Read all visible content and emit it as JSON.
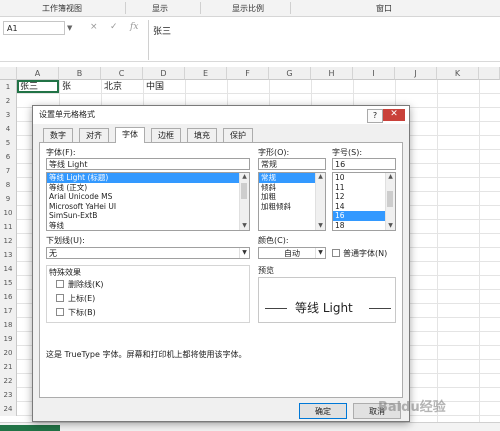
{
  "ribbon": {
    "groups": [
      "工作簿视图",
      "显示",
      "显示比例",
      "窗口"
    ]
  },
  "formula_bar": {
    "name_box": "A1",
    "cancel_icon": "×",
    "enter_icon": "✓",
    "fx_label": "fx",
    "formula_value": "张三"
  },
  "sheet": {
    "columns": [
      "A",
      "B",
      "C",
      "D",
      "E",
      "F",
      "G",
      "H",
      "I",
      "J",
      "K"
    ],
    "rows": [
      "1",
      "2",
      "3",
      "4",
      "5",
      "6",
      "7",
      "8",
      "9",
      "10",
      "11",
      "12",
      "13",
      "14",
      "15",
      "16",
      "17",
      "18",
      "19",
      "20",
      "21",
      "22",
      "23",
      "24"
    ],
    "row1": {
      "A": "张三",
      "B": "张",
      "C": "北京",
      "D": "中国"
    }
  },
  "dialog": {
    "title": "设置单元格格式",
    "help": "?",
    "close": "✕",
    "tabs": [
      "数字",
      "对齐",
      "字体",
      "边框",
      "填充",
      "保护"
    ],
    "active_tab": "字体",
    "font": {
      "label": "字体(F):",
      "value": "等线 Light",
      "items": [
        "等线 Light (标题)",
        "等线 (正文)",
        "Arial Unicode MS",
        "Microsoft YaHei UI",
        "SimSun-ExtB",
        "等线"
      ]
    },
    "style": {
      "label": "字形(O):",
      "value": "常规",
      "items": [
        "常规",
        "倾斜",
        "加粗",
        "加粗倾斜"
      ]
    },
    "size": {
      "label": "字号(S):",
      "value": "16",
      "items": [
        "10",
        "11",
        "12",
        "14",
        "16",
        "18"
      ]
    },
    "underline": {
      "label": "下划线(U):",
      "value": "无"
    },
    "color": {
      "label": "颜色(C):",
      "value": "自动"
    },
    "normal_font": {
      "label": "普通字体(N)"
    },
    "effects": {
      "label": "特殊效果",
      "items": [
        "删除线(K)",
        "上标(E)",
        "下标(B)"
      ]
    },
    "preview": {
      "label": "预览",
      "text": "等线 Light"
    },
    "info": "这是 TrueType 字体。屏幕和打印机上都将使用该字体。",
    "ok": "确定",
    "cancel": "取消"
  },
  "watermark": "Baidu经验"
}
